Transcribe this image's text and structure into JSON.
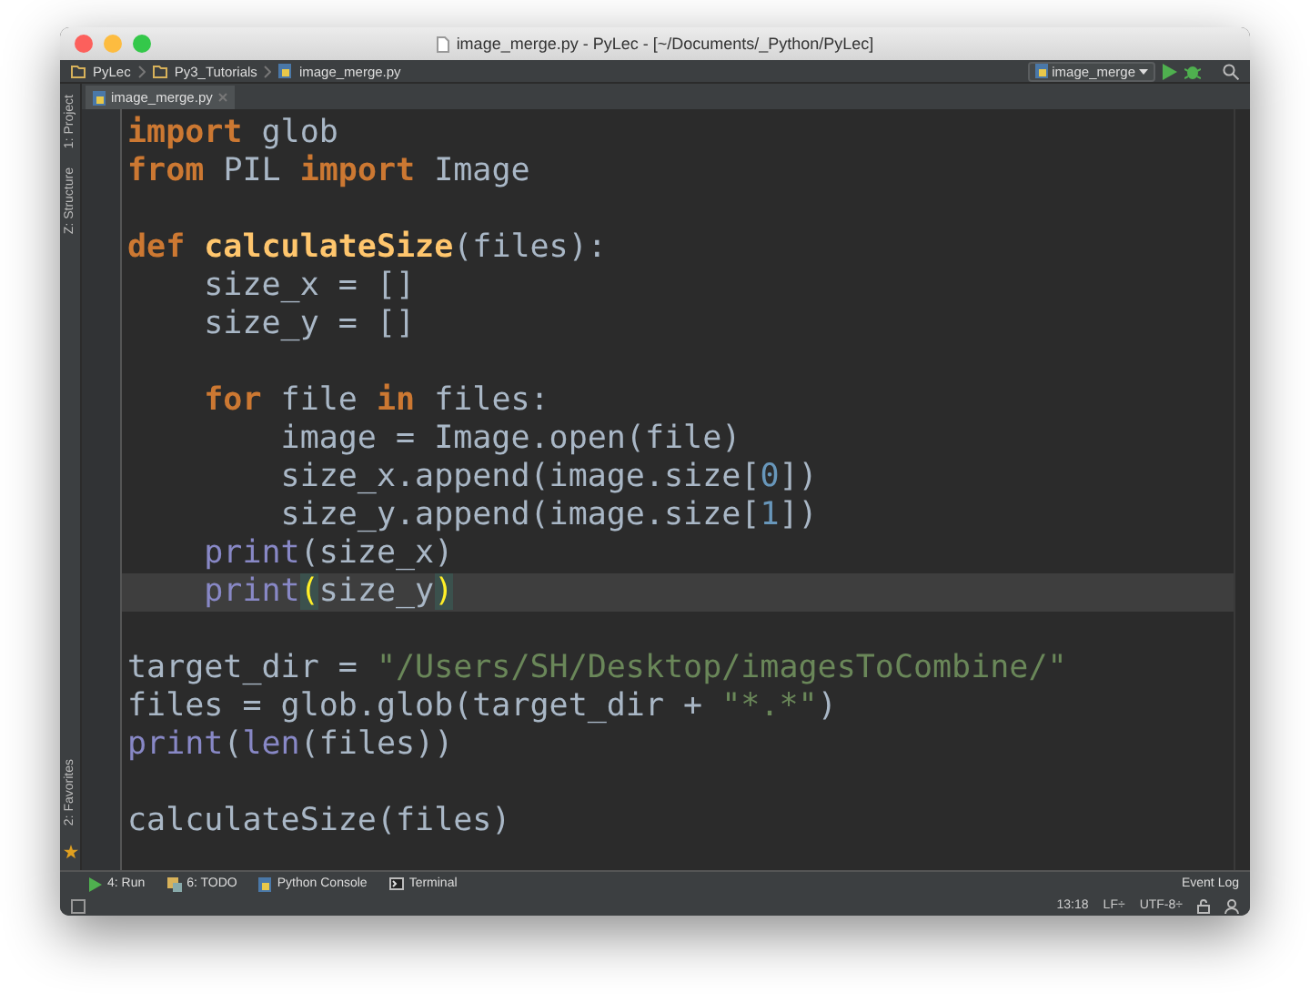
{
  "window": {
    "title": "image_merge.py - PyLec - [~/Documents/_Python/PyLec]"
  },
  "breadcrumbs": [
    {
      "label": "PyLec",
      "kind": "folder"
    },
    {
      "label": "Py3_Tutorials",
      "kind": "folder"
    },
    {
      "label": "image_merge.py",
      "kind": "file"
    }
  ],
  "run_config": {
    "label": "image_merge"
  },
  "side_tools": {
    "top": [
      {
        "label": "1: Project"
      },
      {
        "label": "Z: Structure"
      }
    ],
    "bottom": [
      {
        "label": "2: Favorites"
      }
    ]
  },
  "tabs": [
    {
      "label": "image_merge.py",
      "selected": true
    }
  ],
  "code": [
    {
      "kind": "code",
      "tokens": [
        {
          "kind": "kw",
          "text": "import"
        },
        {
          "kind": "plain",
          "text": " glob"
        }
      ]
    },
    {
      "kind": "code",
      "tokens": [
        {
          "kind": "kw",
          "text": "from"
        },
        {
          "kind": "plain",
          "text": " PIL "
        },
        {
          "kind": "kw",
          "text": "import"
        },
        {
          "kind": "plain",
          "text": " Image"
        }
      ]
    },
    {
      "kind": "blank"
    },
    {
      "kind": "code",
      "tokens": [
        {
          "kind": "kw",
          "text": "def"
        },
        {
          "kind": "def",
          "text": " calculateSize"
        },
        {
          "kind": "plain",
          "text": "(files):"
        }
      ]
    },
    {
      "kind": "code",
      "tokens": [
        {
          "kind": "plain",
          "text": "    size_x = []"
        }
      ]
    },
    {
      "kind": "code",
      "tokens": [
        {
          "kind": "plain",
          "text": "    size_y = []"
        }
      ]
    },
    {
      "kind": "blank"
    },
    {
      "kind": "code",
      "tokens": [
        {
          "kind": "kw",
          "text": "    for"
        },
        {
          "kind": "plain",
          "text": " file "
        },
        {
          "kind": "kw",
          "text": "in"
        },
        {
          "kind": "plain",
          "text": " files:"
        }
      ]
    },
    {
      "kind": "code",
      "tokens": [
        {
          "kind": "plain",
          "text": "        image = Image.open(file)"
        }
      ]
    },
    {
      "kind": "code",
      "tokens": [
        {
          "kind": "plain",
          "text": "        size_x.append(image.size["
        },
        {
          "kind": "num",
          "text": "0"
        },
        {
          "kind": "plain",
          "text": "])"
        }
      ]
    },
    {
      "kind": "code",
      "tokens": [
        {
          "kind": "plain",
          "text": "        size_y.append(image.size["
        },
        {
          "kind": "num",
          "text": "1"
        },
        {
          "kind": "plain",
          "text": "])"
        }
      ]
    },
    {
      "kind": "code",
      "tokens": [
        {
          "kind": "builtin",
          "text": "    print"
        },
        {
          "kind": "plain",
          "text": "(size_x)"
        }
      ]
    },
    {
      "kind": "code",
      "current": true,
      "tokens": [
        {
          "kind": "builtin",
          "text": "    print"
        },
        {
          "kind": "match",
          "text": "("
        },
        {
          "kind": "plain",
          "text": "size_y"
        },
        {
          "kind": "match",
          "text": ")"
        }
      ]
    },
    {
      "kind": "blank"
    },
    {
      "kind": "code",
      "tokens": [
        {
          "kind": "plain",
          "text": "target_dir = "
        },
        {
          "kind": "str",
          "text": "\"/Users/SH/Desktop/imagesToCombine/\""
        }
      ]
    },
    {
      "kind": "code",
      "tokens": [
        {
          "kind": "plain",
          "text": "files = glob.glob(target_dir + "
        },
        {
          "kind": "str",
          "text": "\"*.*\""
        },
        {
          "kind": "plain",
          "text": ")"
        }
      ]
    },
    {
      "kind": "code",
      "tokens": [
        {
          "kind": "builtin",
          "text": "print"
        },
        {
          "kind": "plain",
          "text": "("
        },
        {
          "kind": "builtin",
          "text": "len"
        },
        {
          "kind": "plain",
          "text": "(files))"
        }
      ]
    },
    {
      "kind": "blank"
    },
    {
      "kind": "code",
      "tokens": [
        {
          "kind": "plain",
          "text": "calculateSize(files)"
        }
      ]
    }
  ],
  "tool_windows": [
    {
      "label": "4: Run",
      "kind": "run"
    },
    {
      "label": "6: TODO",
      "kind": "todo"
    },
    {
      "label": "Python Console",
      "kind": "console"
    },
    {
      "label": "Terminal",
      "kind": "terminal"
    }
  ],
  "event_log": {
    "label": "Event Log"
  },
  "status_bar": {
    "position": "13:18",
    "line_sep": "LF÷",
    "encoding": "UTF-8÷"
  }
}
